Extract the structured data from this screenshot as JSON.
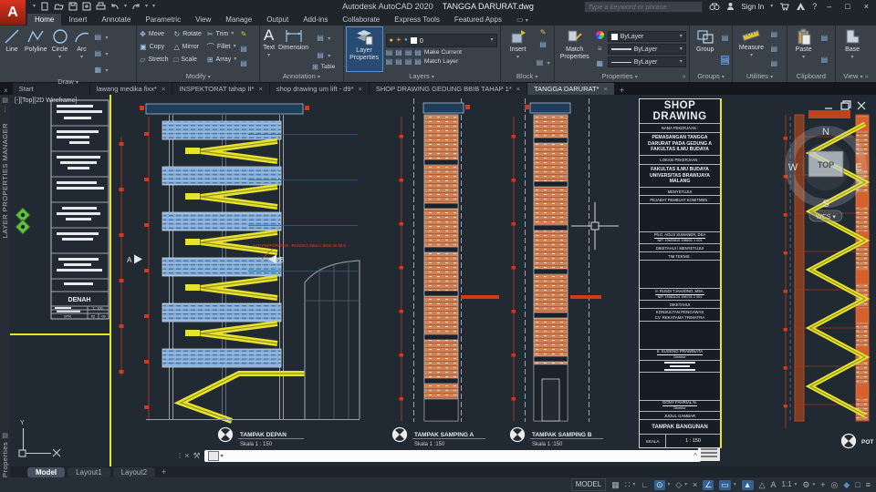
{
  "titlebar": {
    "app_initial": "A",
    "product": "Autodesk AutoCAD 2020",
    "document": "TANGGA DARURAT.dwg",
    "search_placeholder": "Type a keyword or phrase",
    "sign_in": "Sign In"
  },
  "glyphs": {
    "caret": "▾",
    "close": "×",
    "chip": "▤",
    "expander": "»",
    "dots": "⁞",
    "up": "^",
    "bulb": "●",
    "sun": "☀",
    "lock": "●",
    "lines": "≡",
    "hatch": "▦",
    "pencil": "✎",
    "minimize": "–",
    "restore": "□",
    "help": "?",
    "plus": "+"
  },
  "ribbon_tabs": {
    "items": [
      {
        "label": "Home"
      },
      {
        "label": "Insert"
      },
      {
        "label": "Annotate"
      },
      {
        "label": "Parametric"
      },
      {
        "label": "View"
      },
      {
        "label": "Manage"
      },
      {
        "label": "Output"
      },
      {
        "label": "Add-ins"
      },
      {
        "label": "Collaborate"
      },
      {
        "label": "Express Tools"
      },
      {
        "label": "Featured Apps"
      }
    ]
  },
  "ribbon": {
    "draw": {
      "label": "Draw",
      "line": "Line",
      "polyline": "Polyline",
      "circle": "Circle",
      "arc": "Arc"
    },
    "modify": {
      "label": "Modify",
      "move": "Move",
      "rotate": "Rotate",
      "trim": "Trim",
      "copy": "Copy",
      "mirror": "Mirror",
      "fillet": "Fillet",
      "stretch": "Stretch",
      "scale": "Scale",
      "array": "Array"
    },
    "annotation": {
      "label": "Annotation",
      "text": "Text",
      "dimension": "Dimension",
      "table": "Table"
    },
    "layers": {
      "label": "Layers",
      "layer_properties": "Layer Properties",
      "current_layer": "0",
      "make_current": "Make Current",
      "match_layer": "Match Layer"
    },
    "block": {
      "label": "Block",
      "insert": "Insert"
    },
    "properties": {
      "label": "Properties",
      "match_properties": "Match Properties",
      "color": "ByLayer",
      "lineweight": "ByLayer",
      "linetype": "ByLayer"
    },
    "groups": {
      "label": "Groups",
      "group": "Group"
    },
    "utilities": {
      "label": "Utilities",
      "measure": "Measure"
    },
    "clipboard": {
      "label": "Clipboard",
      "paste": "Paste"
    },
    "view": {
      "label": "View",
      "base": "Base"
    }
  },
  "file_tabs": {
    "items": [
      {
        "label": "Start"
      },
      {
        "label": "lawang medika fixx*"
      },
      {
        "label": "INSPEKTORAT tahap II*"
      },
      {
        "label": "shop drawing um lift - d9*"
      },
      {
        "label": "SHOP DRAWING GEDUNG BBIB TAHAP 1*"
      },
      {
        "label": "TANGGA DARURAT*"
      }
    ]
  },
  "dock": {
    "layer_manager": "LAYER PROPERTIES MANAGER",
    "properties": "Properties"
  },
  "viewport": {
    "label": "[-][Top][2D Wireframe]",
    "cube": {
      "n": "N",
      "s": "S",
      "e": "E",
      "w": "W",
      "top": "TOP",
      "wcs": "WCS ▾"
    }
  },
  "views": [
    {
      "name": "TAMPAK DEPAN",
      "scale": "Skala 1 : 150"
    },
    {
      "name": "TAMPAK SAMPING A",
      "scale": "Skala 1 :150"
    },
    {
      "name": "TAMPAK SAMPING B",
      "scale": "Skala 1 :150"
    },
    {
      "name": "POT",
      "scale": ""
    }
  ],
  "drawing_annotations": {
    "acp": "ACP PERFORATED - RANGKA SIKU L BESI 50.50.5",
    "marker_a": "A",
    "marker_b": "B"
  },
  "mini_titleblock": {
    "title": "DENAH",
    "scale": "1 : 100",
    "col1": "STR",
    "col2": "02",
    "col3": "09"
  },
  "titleblock": {
    "header": "SHOP DRAWING",
    "nama_label": "NAMA PEKERJAAN :",
    "nama": "PEMASANGAN TANGGA DARURAT PADA GEDUNG A FAKULTAS ILMU BUDAYA",
    "lokasi_label": "LOKASI PEKERJAAN :",
    "lokasi": "FAKULTAS ILMU BUDAYA UNIVERSITAS BRAWIJAYA MALANG",
    "menyetujui": "MENYETUJUI",
    "ppk_label": "PEJABAT PEMBUAT KOMITMEN :",
    "ppk_name": "Ph.D. AGUS SUMANER, DEA",
    "ppk_nip": "NIP. 19600810 198601 1 001",
    "diketahui_menyetujui": "DIKETAHUI / MENYETUJUI",
    "tim_teknis": "TIM TEKNIS :",
    "tim_name": "Ir. RUSDI TJAHJONO, MSA.",
    "tim_nip": "NIP. 19581124 198701 1 001",
    "diketahui": "DIKETAHUI",
    "konsultan_1": "KONSULTAN PENGAWAS",
    "konsultan_2": "CV. REKATAMA TRIMATRA",
    "direktur1_name": "Ir. SUGENG PRAWINATA",
    "direktur1_title": "Direktur",
    "direktur2_name": "DONY FAHRIAL N.",
    "direktur2_title": "Direktur",
    "judul_label": "JUDUL GAMBAR",
    "judul": "TAMPAK BANGUNAN",
    "skala_label": "SKALA",
    "skala_value": "1 : 150"
  },
  "layout_tabs": {
    "model": "Model",
    "layout1": "Layout1",
    "layout2": "Layout2"
  },
  "statusbar": {
    "model": "MODEL",
    "icons": [
      {
        "name": "grid-icon",
        "glyph": "▦"
      },
      {
        "name": "snap-icon",
        "glyph": "∷"
      },
      {
        "name": "ortho-icon",
        "glyph": "∟"
      },
      {
        "name": "polar-tracking-icon",
        "glyph": "⊙"
      },
      {
        "name": "isodraft-icon",
        "glyph": "◇"
      },
      {
        "name": "object-snap-tracking-icon",
        "glyph": "×"
      },
      {
        "name": "dynamic-input-icon",
        "glyph": "∠"
      },
      {
        "name": "selection-cycling-icon",
        "glyph": "▭"
      },
      {
        "name": "object-snap-icon",
        "glyph": "▲"
      },
      {
        "name": "object-snap-3d-icon",
        "glyph": "△"
      },
      {
        "name": "annotation-visibility-icon",
        "glyph": "A"
      },
      {
        "name": "annotation-scale",
        "glyph": "1:1"
      },
      {
        "name": "settings-gear-icon",
        "glyph": "⚙"
      },
      {
        "name": "plus-icon",
        "glyph": "+"
      },
      {
        "name": "isolate-objects-icon",
        "glyph": "◎"
      },
      {
        "name": "graphics-performance-icon",
        "glyph": "◆"
      },
      {
        "name": "clean-screen-icon",
        "glyph": "□"
      },
      {
        "name": "hamburger-menu-icon",
        "glyph": "≡"
      }
    ]
  },
  "colors": {
    "accent_blue": "#4e8fd0",
    "stair_yellow": "#e6e22e",
    "dim_red": "#c43a1a",
    "panel_blue": "#7fa9d6",
    "hatch_orange": "#d08257",
    "sheet_yellow": "#ece32b"
  }
}
